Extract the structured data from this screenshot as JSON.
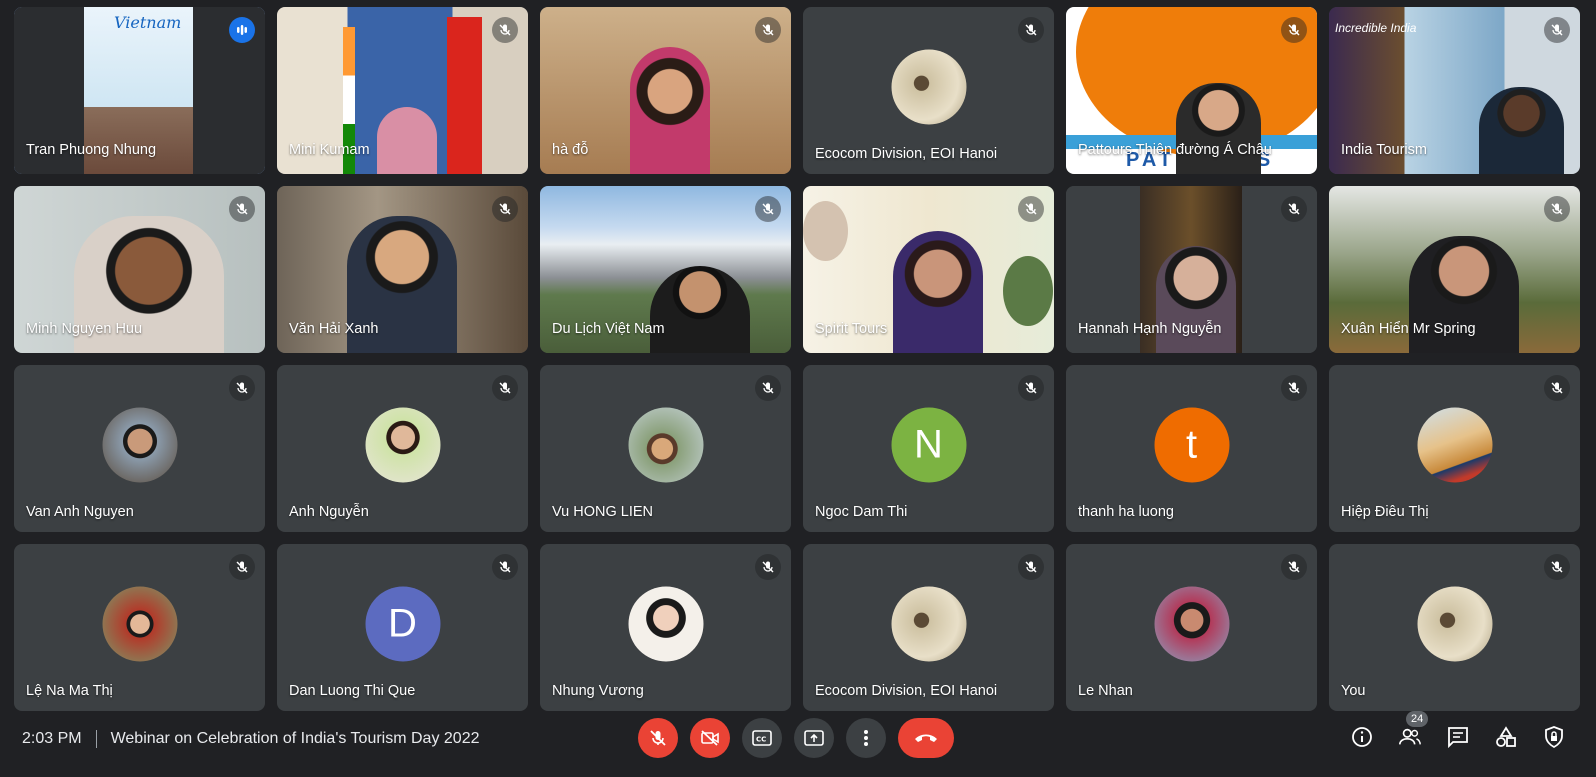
{
  "meeting": {
    "time": "2:03 PM",
    "title": "Webinar on Celebration of India's Tourism Day 2022",
    "participant_count": "24"
  },
  "tiles": [
    {
      "name": "Tran Phuong Nhung",
      "kind": "video",
      "speaking": true
    },
    {
      "name": "Mini Kumam",
      "kind": "video"
    },
    {
      "name": "hà đỗ",
      "kind": "video"
    },
    {
      "name": "Ecocom Division, EOI Hanoi",
      "kind": "avatar-photo"
    },
    {
      "name": "Pattours Thiên đường Á Châu",
      "kind": "video",
      "logo_text": "PAT TOURS"
    },
    {
      "name": "India Tourism",
      "kind": "video",
      "banner_text": "Incredible India"
    },
    {
      "name": "Minh Nguyen Huu",
      "kind": "video"
    },
    {
      "name": "Văn Hải Xanh",
      "kind": "video"
    },
    {
      "name": "Du Lịch Việt Nam",
      "kind": "video"
    },
    {
      "name": "Spirit Tours",
      "kind": "video"
    },
    {
      "name": "Hannah Hạnh Nguyễn",
      "kind": "video"
    },
    {
      "name": "Xuân Hiển Mr Spring",
      "kind": "video"
    },
    {
      "name": "Van Anh Nguyen",
      "kind": "avatar-photo"
    },
    {
      "name": "Anh Nguyễn",
      "kind": "avatar-photo"
    },
    {
      "name": "Vu HONG LIEN",
      "kind": "avatar-photo"
    },
    {
      "name": "Ngoc Dam Thi",
      "kind": "avatar-letter",
      "letter": "N",
      "color": "#7cb342"
    },
    {
      "name": "thanh ha luong",
      "kind": "avatar-letter",
      "letter": "t",
      "color": "#ef6c00"
    },
    {
      "name": "Hiệp Điêu Thị",
      "kind": "avatar-photo"
    },
    {
      "name": "Lệ Na Ma Thị",
      "kind": "avatar-photo"
    },
    {
      "name": "Dan Luong Thi Que",
      "kind": "avatar-letter",
      "letter": "D",
      "color": "#5c6bc0"
    },
    {
      "name": "Nhung Vương",
      "kind": "avatar-photo"
    },
    {
      "name": "Ecocom Division, EOI Hanoi",
      "kind": "avatar-photo"
    },
    {
      "name": "Le Nhan",
      "kind": "avatar-photo"
    },
    {
      "name": "You",
      "kind": "avatar-photo"
    }
  ],
  "controls": [
    "mic-off",
    "camera-off",
    "captions",
    "present",
    "more",
    "leave-call"
  ],
  "right_controls": [
    "info",
    "people",
    "chat",
    "activities",
    "host-controls"
  ],
  "colors": {
    "background": "#202124",
    "tile": "#3c4043",
    "danger": "#ea4335",
    "active_outline": "#8ab4f8"
  }
}
